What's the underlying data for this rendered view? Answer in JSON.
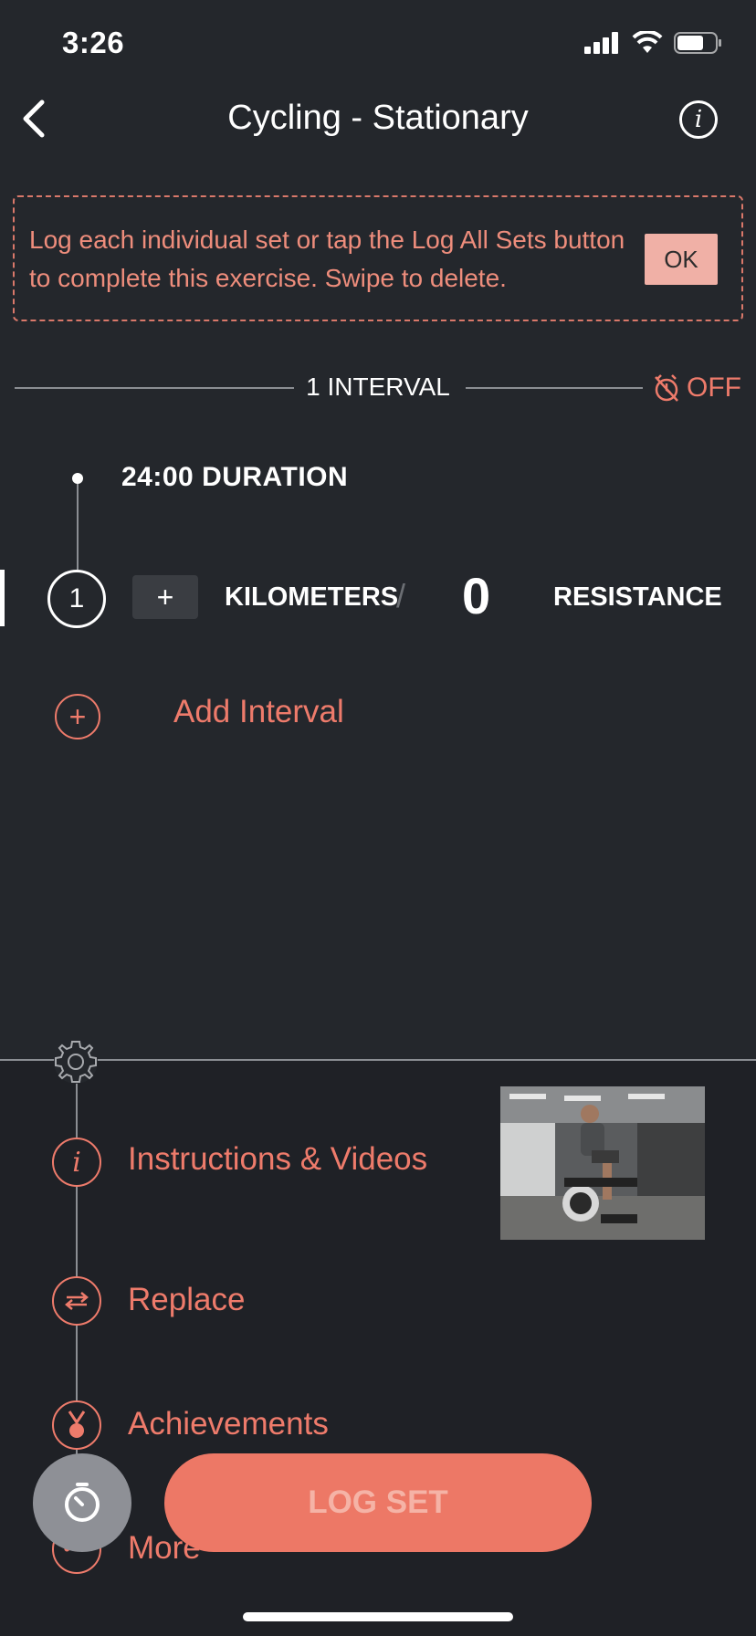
{
  "status_bar": {
    "time": "3:26"
  },
  "nav": {
    "title": "Cycling - Stationary"
  },
  "banner": {
    "message": "Log each individual set or tap the Log All Sets button to complete this exercise. Swipe to delete.",
    "ok_label": "OK"
  },
  "intervals": {
    "header": "1 INTERVAL",
    "timer_label": "OFF",
    "duration_label": "24:00 DURATION",
    "sets": [
      {
        "number": "1",
        "plus_label": "+",
        "distance_unit": "KILOMETERS",
        "separator": "/",
        "resistance_value": "0",
        "resistance_label": "RESISTANCE"
      }
    ],
    "add_label": "Add Interval"
  },
  "menu": {
    "items": [
      {
        "label": "Instructions & Videos",
        "icon": "info-icon"
      },
      {
        "label": "Replace",
        "icon": "swap-icon"
      },
      {
        "label": "Achievements",
        "icon": "medal-icon"
      },
      {
        "label": "More",
        "icon": "more-icon"
      }
    ]
  },
  "actions": {
    "log_label": "LOG SET"
  },
  "colors": {
    "accent": "#ee7b6b",
    "background": "#24272c",
    "banner_ok_bg": "#f0b0a6"
  }
}
